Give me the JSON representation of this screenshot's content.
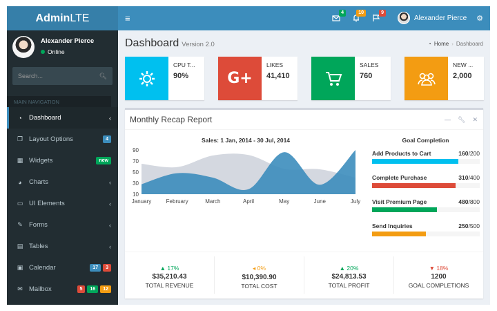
{
  "header": {
    "logo_bold": "Admin",
    "logo_rest": "LTE",
    "toggle_icon": "hamburger-icon",
    "messages_count": "4",
    "notifications_count": "10",
    "tasks_count": "9",
    "user_name": "Alexander Pierce",
    "colors": {
      "logo_bg": "#367fa9",
      "navbar_bg": "#3c8dbc",
      "green": "#00a65a",
      "yellow": "#f39c12",
      "red": "#dd4b39"
    }
  },
  "sidebar": {
    "user_name": "Alexander Pierce",
    "status": "Online",
    "search_placeholder": "Search...",
    "nav_header": "MAIN NAVIGATION",
    "items": [
      {
        "label": "Dashboard",
        "icon": "dashboard-icon",
        "active": true
      },
      {
        "label": "Layout Options",
        "icon": "files-icon",
        "badges": [
          "4"
        ]
      },
      {
        "label": "Widgets",
        "icon": "th-icon",
        "badges": [
          "new"
        ]
      },
      {
        "label": "Charts",
        "icon": "pie-chart-icon"
      },
      {
        "label": "UI Elements",
        "icon": "laptop-icon"
      },
      {
        "label": "Forms",
        "icon": "edit-icon"
      },
      {
        "label": "Tables",
        "icon": "table-icon"
      },
      {
        "label": "Calendar",
        "icon": "calendar-icon",
        "badges": [
          "17",
          "3"
        ]
      },
      {
        "label": "Mailbox",
        "icon": "envelope-icon",
        "badges": [
          "5",
          "16",
          "12"
        ]
      }
    ]
  },
  "page": {
    "title": "Dashboard",
    "subtitle": "Version 2.0",
    "breadcrumb": [
      "Home",
      "Dashboard"
    ]
  },
  "infoboxes": [
    {
      "label": "CPU T...",
      "value": "90%",
      "color": "#00c0ef",
      "icon": "gear-icon"
    },
    {
      "label": "LIKES",
      "value": "41,410",
      "color": "#dd4b39",
      "icon": "google-plus-icon"
    },
    {
      "label": "SALES",
      "value": "760",
      "color": "#00a65a",
      "icon": "shopping-cart-icon"
    },
    {
      "label": "NEW ...",
      "value": "2,000",
      "color": "#f39c12",
      "icon": "users-icon"
    }
  ],
  "report": {
    "title": "Monthly Recap Report",
    "chart_title": "Sales: 1 Jan, 2014 - 30 Jul, 2014",
    "goal_title": "Goal Completion",
    "goals": [
      {
        "name": "Add Products to Cart",
        "value": "160",
        "total": "/200",
        "fraction": 0.8,
        "color": "#00c0ef"
      },
      {
        "name": "Complete Purchase",
        "value": "310",
        "total": "/400",
        "fraction": 0.775,
        "color": "#dd4b39"
      },
      {
        "name": "Visit Premium Page",
        "value": "480",
        "total": "/800",
        "fraction": 0.6,
        "color": "#00a65a"
      },
      {
        "name": "Send Inquiries",
        "value": "250",
        "total": "/500",
        "fraction": 0.5,
        "color": "#f39c12"
      }
    ],
    "stats": [
      {
        "arrow": "▲",
        "pct": "17%",
        "amount": "$35,210.43",
        "label": "TOTAL REVENUE",
        "color": "#00a65a"
      },
      {
        "arrow": "◂",
        "pct": "0%",
        "amount": "$10,390.90",
        "label": "TOTAL COST",
        "color": "#f39c12"
      },
      {
        "arrow": "▲",
        "pct": "20%",
        "amount": "$24,813.53",
        "label": "TOTAL PROFIT",
        "color": "#00a65a"
      },
      {
        "arrow": "▼",
        "pct": "18%",
        "amount": "1200",
        "label": "GOAL COMPLETIONS",
        "color": "#dd4b39"
      }
    ]
  },
  "chart_data": {
    "type": "area",
    "title": "Sales: 1 Jan, 2014 - 30 Jul, 2014",
    "categories": [
      "January",
      "February",
      "March",
      "April",
      "May",
      "June",
      "July"
    ],
    "yticks": [
      10,
      30,
      50,
      70,
      90
    ],
    "ylim": [
      10,
      90
    ],
    "series": [
      {
        "values": [
          65,
          59,
          80,
          81,
          56,
          55,
          40
        ],
        "color": "#d2d6de"
      },
      {
        "values": [
          28,
          48,
          40,
          19,
          86,
          27,
          90
        ],
        "color": "#3c8dbc"
      }
    ],
    "grid": false
  }
}
